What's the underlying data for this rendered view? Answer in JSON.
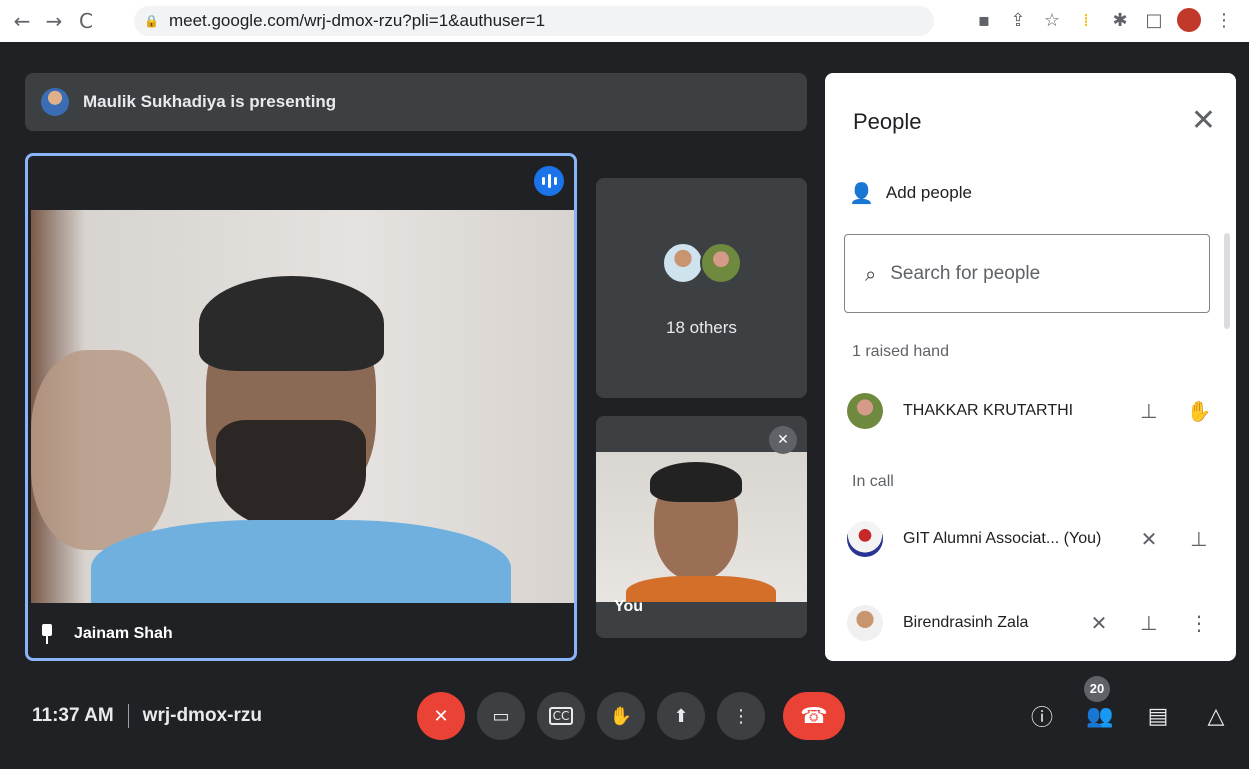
{
  "browser": {
    "back_icon": "arrow-left-icon",
    "forward_icon": "arrow-right-icon",
    "reload_icon": "reload-icon",
    "url": "meet.google.com/wrj-dmox-rzu?pli=1&authuser=1",
    "nav": {
      "back": "←",
      "forward": "→",
      "reload": "C"
    }
  },
  "presentation": {
    "presenter_text": "Maulik Sukhadiya is presenting"
  },
  "main_tile": {
    "name": "Jainam Shah"
  },
  "others_tile": {
    "label": "18 others"
  },
  "self_tile": {
    "label": "You"
  },
  "people_panel": {
    "title": "People",
    "add_people_label": "Add people",
    "search_placeholder": "Search for people",
    "raised_hand_header": "1 raised hand",
    "in_call_header": "In call",
    "raised_hands": [
      {
        "name": "THAKKAR KRUTARTHI"
      }
    ],
    "in_call": [
      {
        "name": "GIT Alumni Associat... (You)"
      },
      {
        "name": "Birendrasinh Zala"
      }
    ]
  },
  "bottom_bar": {
    "time": "11:37 AM",
    "meeting_code": "wrj-dmox-rzu",
    "participant_count": "20"
  },
  "colors": {
    "accent_blue": "#8ab4f8",
    "mic_off_red": "#ea4335",
    "background": "#202124"
  }
}
